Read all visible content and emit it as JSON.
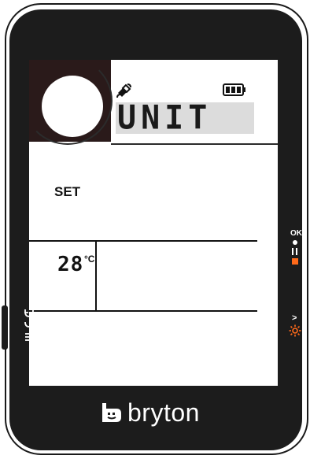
{
  "device": {
    "brand": "bryton"
  },
  "status_bar": {
    "satellite_icon": "satellite-icon",
    "battery_icon": "battery-icon"
  },
  "page": {
    "title": "UNIT",
    "set_label": "SET"
  },
  "temperature": {
    "value": "28",
    "unit": "°C"
  },
  "buttons": {
    "right_top": {
      "label": "OK",
      "icons": [
        "record-dot-icon",
        "pause-icon",
        "stop-icon"
      ]
    },
    "right_bottom": {
      "label": ">",
      "icons": [
        "backlight-icon"
      ]
    },
    "left": {
      "icons": [
        "menu-icon",
        "back-icon"
      ]
    }
  },
  "colors": {
    "body": "#1c1c1c",
    "screen": "#ffffff",
    "accent": "#ff6a1a"
  }
}
